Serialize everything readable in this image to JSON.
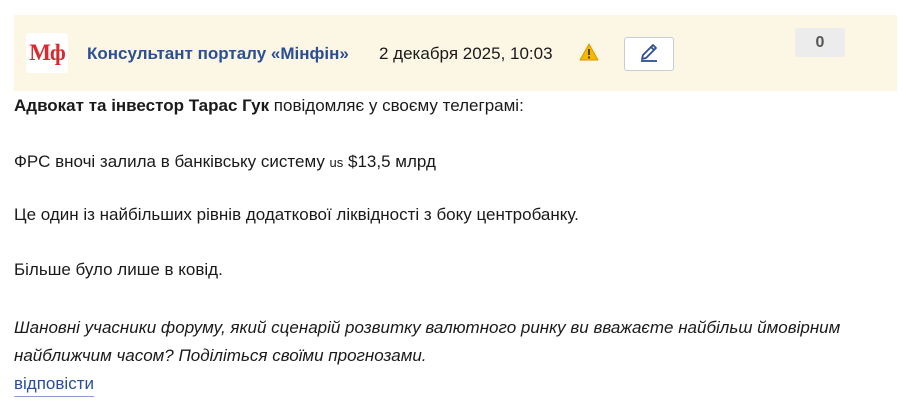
{
  "post": {
    "author_logo": "Мф",
    "author": "Консультант порталу «Мінфін»",
    "date": "2 декабря 2025, 10:03",
    "score": "0",
    "icons": {
      "warning": "warning-icon",
      "edit": "pencil-icon"
    },
    "colors": {
      "header_bg": "#fcf6e4",
      "author": "#2b4f93",
      "logo": "#d8292f",
      "warning": "#f5b800"
    }
  },
  "body": {
    "intro_bold": "Адвокат та інвестор Тарас Гук",
    "intro_rest": " повідомляє у своєму телеграмі:",
    "line2_before": "ФРС вночі залила в банківську систему ",
    "line2_currency": "us",
    "line2_after": " $13,5 млрд",
    "line3": "Це один із найбільших рівнів додаткової ліквідності з боку центробанку.",
    "line4": "Більше було лише в ковід.",
    "question": "Шановні учасники форуму, який сценарій розвитку валютного ринку ви вважаєте найбільш ймовірним найближчим часом? Поділіться своїми прогнозами."
  },
  "actions": {
    "reply": "відповісти"
  }
}
